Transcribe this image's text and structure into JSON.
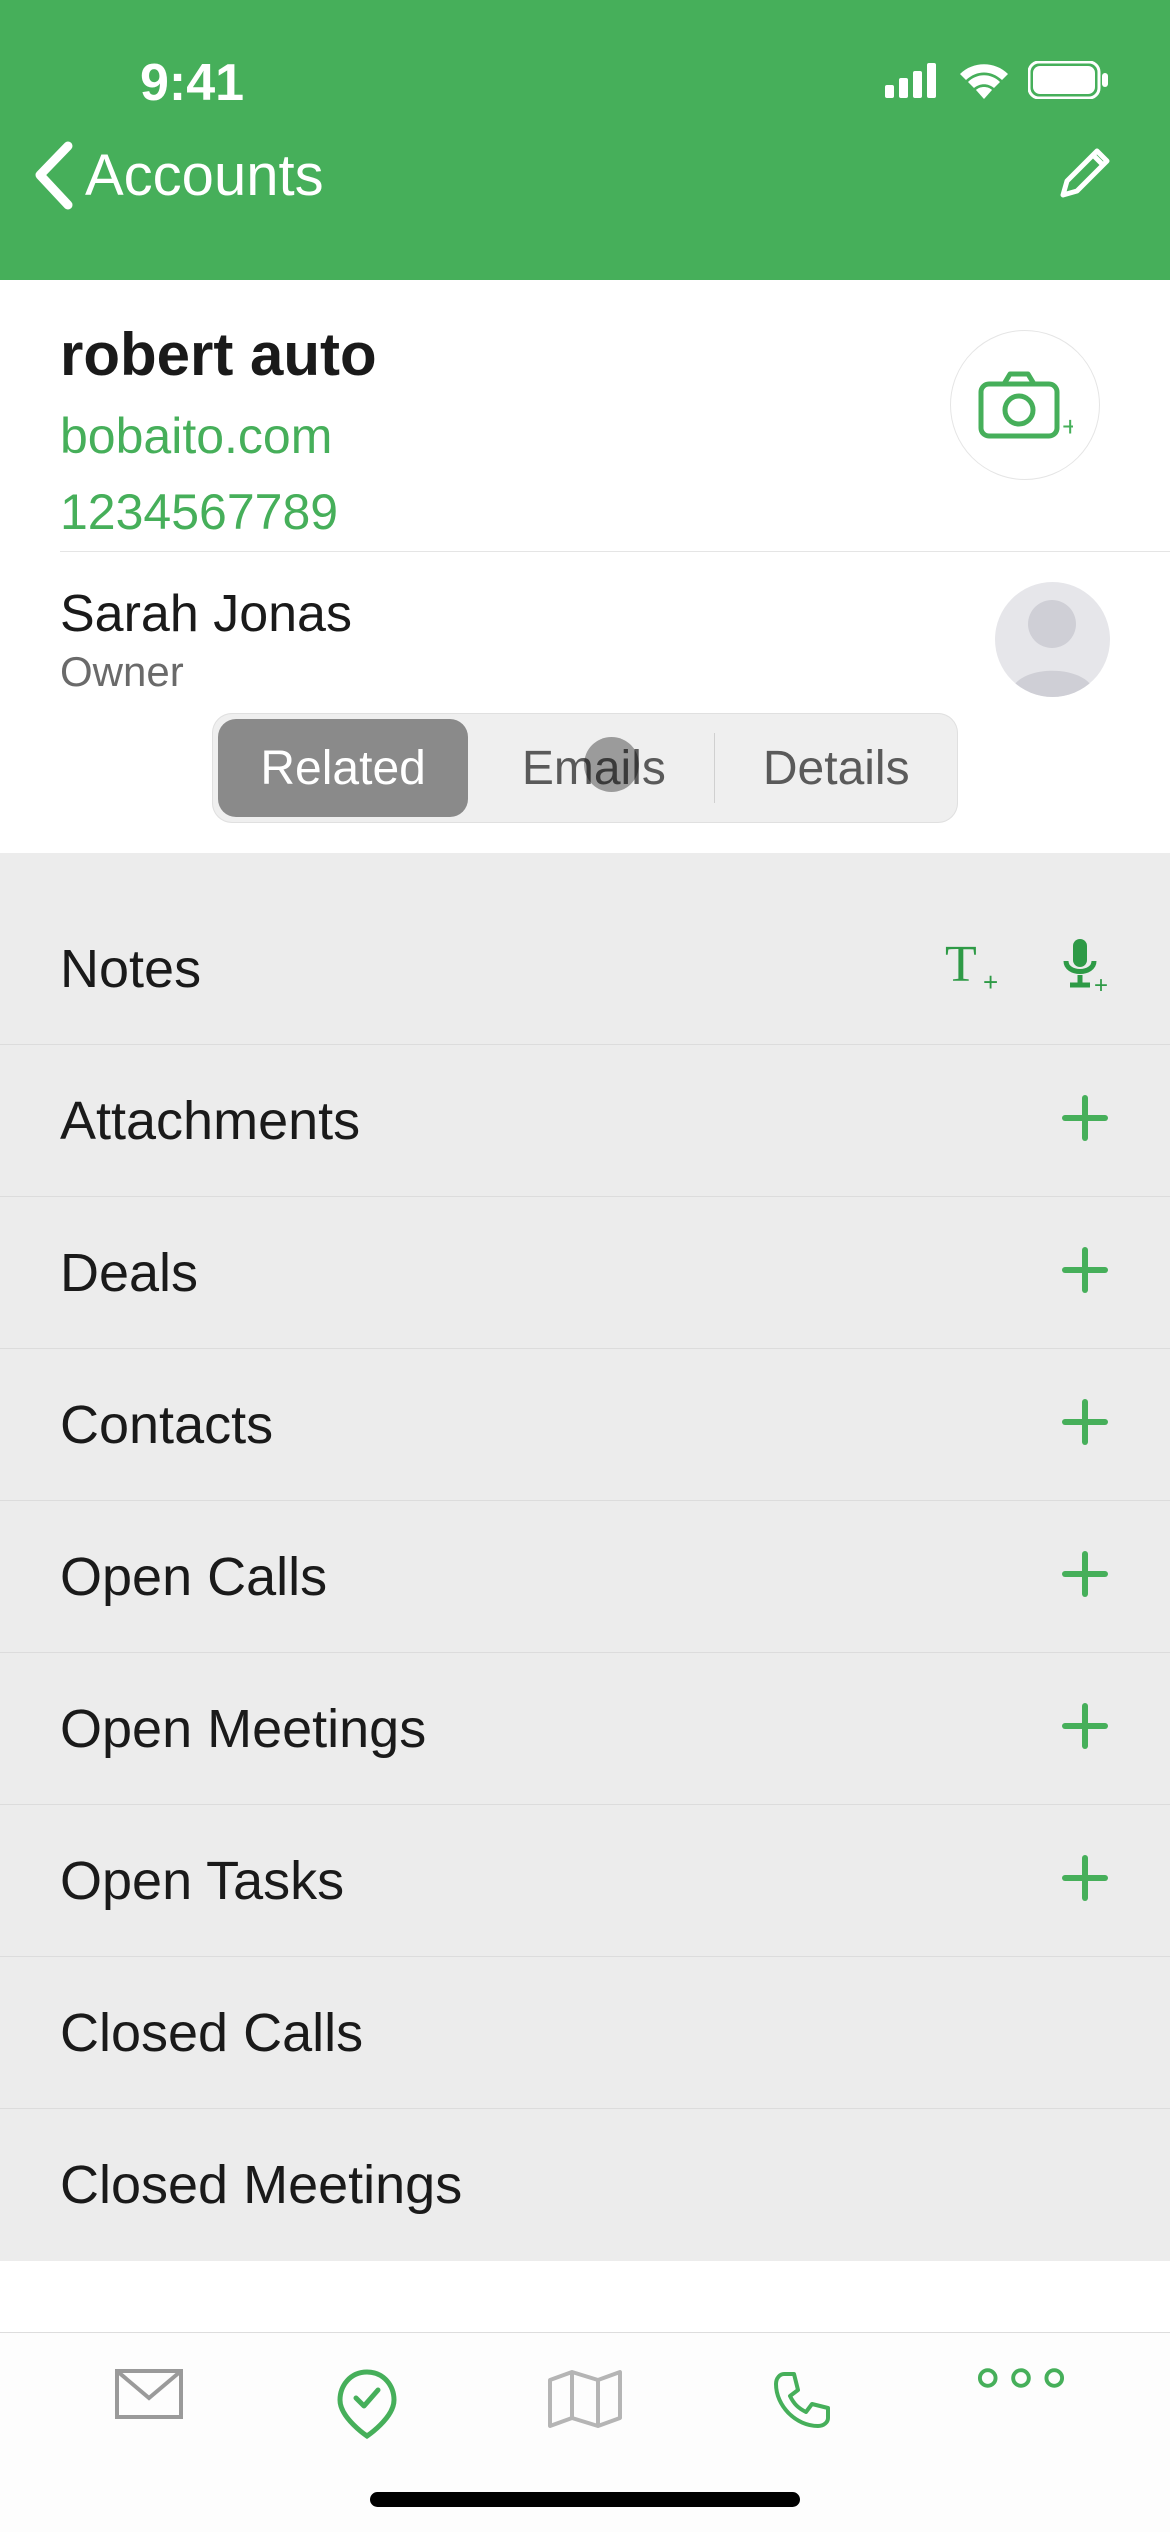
{
  "status": {
    "time": "9:41"
  },
  "nav": {
    "back_label": "Accounts"
  },
  "account": {
    "name": "robert auto",
    "website": "bobaito.com",
    "phone": "1234567789"
  },
  "owner": {
    "name": "Sarah Jonas",
    "role": "Owner"
  },
  "tabs": {
    "related": "Related",
    "emails": "Emails",
    "details": "Details",
    "active": "related"
  },
  "related": {
    "notes": "Notes",
    "attachments": "Attachments",
    "deals": "Deals",
    "contacts": "Contacts",
    "open_calls": "Open Calls",
    "open_meetings": "Open Meetings",
    "open_tasks": "Open Tasks",
    "closed_calls": "Closed Calls",
    "closed_meetings": "Closed Meetings"
  },
  "colors": {
    "primary": "#46af5a"
  }
}
